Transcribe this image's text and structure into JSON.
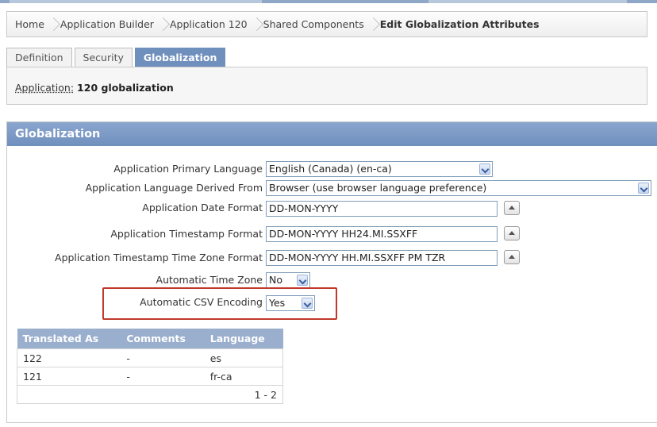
{
  "breadcrumb": {
    "items": [
      "Home",
      "Application Builder",
      "Application 120",
      "Shared Components"
    ],
    "current": "Edit Globalization Attributes"
  },
  "tabs": [
    {
      "label": "Definition",
      "active": false
    },
    {
      "label": "Security",
      "active": false
    },
    {
      "label": "Globalization",
      "active": true
    }
  ],
  "app_info": {
    "label": "Application:",
    "value": "120  globalization"
  },
  "region": {
    "title": "Globalization",
    "fields": {
      "primary_language": {
        "label": "Application Primary Language",
        "value": "English (Canada) (en-ca)"
      },
      "language_derived_from": {
        "label": "Application Language Derived From",
        "value": "Browser (use browser language preference)"
      },
      "date_format": {
        "label": "Application Date Format",
        "value": "DD-MON-YYYY"
      },
      "timestamp_format": {
        "label": "Application Timestamp Format",
        "value": "DD-MON-YYYY HH24.MI.SSXFF"
      },
      "timestamp_tz_format": {
        "label": "Application Timestamp Time Zone Format",
        "value": "DD-MON-YYYY HH.MI.SSXFF PM TZR"
      },
      "automatic_time_zone": {
        "label": "Automatic Time Zone",
        "value": "No"
      },
      "automatic_csv_encoding": {
        "label": "Automatic CSV Encoding",
        "value": "Yes"
      }
    }
  },
  "translations": {
    "headers": [
      "Translated As",
      "Comments",
      "Language"
    ],
    "rows": [
      [
        "122",
        "-",
        "es"
      ],
      [
        "121",
        "-",
        "fr-ca"
      ]
    ],
    "pagination": "1 - 2"
  },
  "colors": {
    "header_blue": "#6f8fbd",
    "highlight_red": "#c0392b"
  },
  "icons": {
    "dropdown": "chevron-down-icon",
    "picker": "caret-up-icon",
    "separator": "chevron-right-icon"
  }
}
